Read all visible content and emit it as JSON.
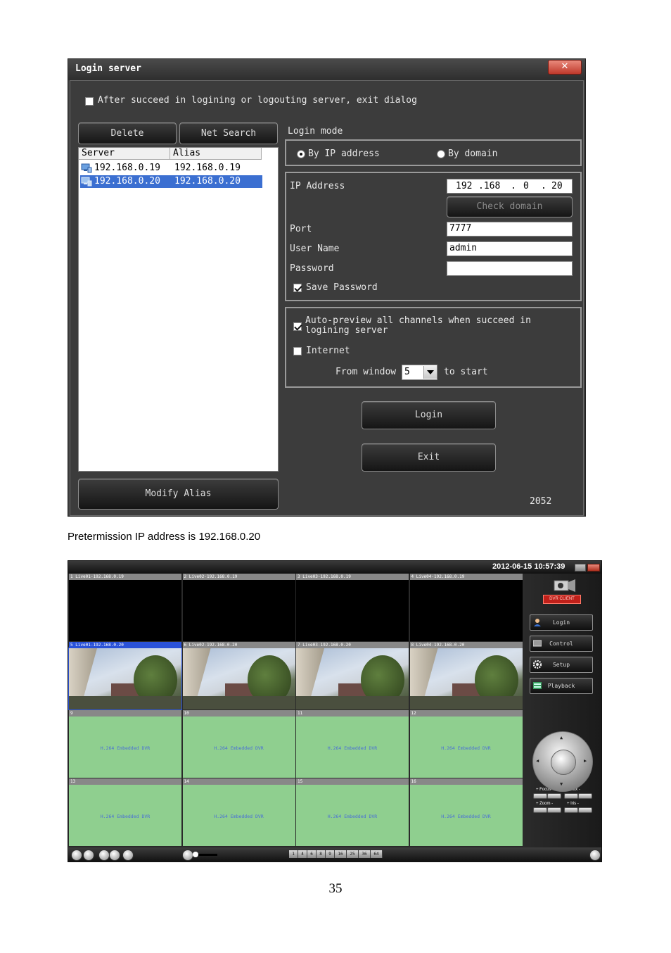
{
  "login_dialog": {
    "title": "Login server",
    "close_label": "✕",
    "exit_dialog_checkbox": "After succeed in logining or logouting server, exit dialog",
    "delete_button": "Delete",
    "net_search_button": "Net Search",
    "columns": [
      "Server",
      "Alias"
    ],
    "servers": [
      {
        "server": "192.168.0.19",
        "alias": "192.168.0.19",
        "icon": "computer-icon",
        "selected": false
      },
      {
        "server": "192.168.0.20",
        "alias": "192.168.0.20",
        "icon": "computer-icon",
        "selected": true
      }
    ],
    "modify_alias_button": "Modify Alias",
    "login_mode_label": "Login mode",
    "by_ip_label": "By IP address",
    "by_domain_label": "By domain",
    "ip_address_label": "IP Address",
    "ip_octets": [
      "192",
      ".168",
      ".",
      "0",
      ".",
      "20"
    ],
    "check_domain_button": "Check domain",
    "port_label": "Port",
    "port_value": "7777",
    "username_label": "User Name",
    "username_value": "admin",
    "password_label": "Password",
    "password_value": "",
    "save_password_label": "Save Password",
    "auto_preview_label": "Auto-preview all channels when succeed in logining server",
    "internet_label": "Internet",
    "from_window_label": "From window",
    "from_window_value": "5",
    "to_start_label": "to start",
    "login_button": "Login",
    "exit_button": "Exit",
    "version": "2052"
  },
  "caption": "Pretermission IP address is 192.168.0.20",
  "dvr_client": {
    "clock": "2012-06-15 10:57:39",
    "logo_text": "DVR CLIENT",
    "channels": [
      {
        "label": "1 Live01-192.168.0.19",
        "state": "black"
      },
      {
        "label": "2 Live02-192.168.0.19",
        "state": "black"
      },
      {
        "label": "3 Live03-192.168.0.19",
        "state": "black"
      },
      {
        "label": "4 Live04-192.168.0.19",
        "state": "black"
      },
      {
        "label": "5 Live01-192.168.0.20",
        "state": "video",
        "active": true
      },
      {
        "label": "6 Live02-192.168.0.20",
        "state": "video"
      },
      {
        "label": "7 Live03-192.168.0.20",
        "state": "video"
      },
      {
        "label": "8 Live04-192.168.0.20",
        "state": "video"
      },
      {
        "label": "9",
        "state": "idle",
        "text": "H.264 Embedded DVR"
      },
      {
        "label": "10",
        "state": "idle",
        "text": "H.264 Embedded DVR"
      },
      {
        "label": "11",
        "state": "idle",
        "text": "H.264 Embedded DVR"
      },
      {
        "label": "12",
        "state": "idle",
        "text": "H.264 Embedded DVR"
      },
      {
        "label": "13",
        "state": "idle",
        "text": "H.264 Embedded DVR"
      },
      {
        "label": "14",
        "state": "idle",
        "text": "H.264 Embedded DVR"
      },
      {
        "label": "15",
        "state": "idle",
        "text": "H.264 Embedded DVR"
      },
      {
        "label": "16",
        "state": "idle",
        "text": "H.264 Embedded DVR"
      }
    ],
    "side_buttons": [
      {
        "label": "Login",
        "icon": "user-icon"
      },
      {
        "label": "Control",
        "icon": "monitor-icon"
      },
      {
        "label": "Setup",
        "icon": "gear-icon"
      },
      {
        "label": "Playback",
        "icon": "film-icon"
      }
    ],
    "ptz_labels": [
      "+ Focus -",
      "+ Aux -",
      "+ Zoom -",
      "+ Iris -"
    ],
    "split_buttons": [
      "1",
      "4",
      "6",
      "8",
      "9",
      "16",
      "25",
      "36",
      "64"
    ]
  },
  "page_number": "35"
}
